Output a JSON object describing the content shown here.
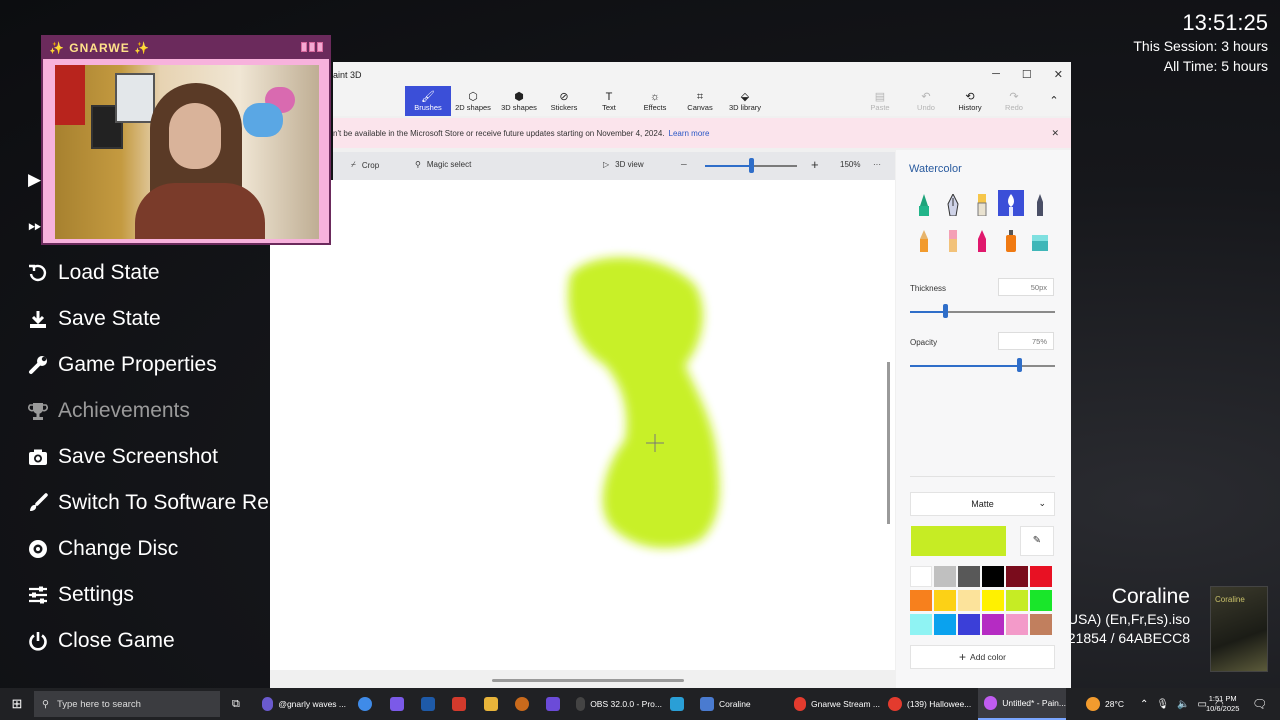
{
  "clock": {
    "time": "13:51:25",
    "session": "This Session: 3 hours",
    "all_time": "All Time: 5 hours"
  },
  "webcam": {
    "title": "✨ GNARWE ✨"
  },
  "emulator_menu": {
    "items": [
      {
        "label": "Load State",
        "icon": "undo-icon",
        "disabled": false
      },
      {
        "label": "Save State",
        "icon": "download-icon",
        "disabled": false
      },
      {
        "label": "Game Properties",
        "icon": "wrench-icon",
        "disabled": false
      },
      {
        "label": "Achievements",
        "icon": "trophy-icon",
        "disabled": true
      },
      {
        "label": "Save Screenshot",
        "icon": "camera-icon",
        "disabled": false
      },
      {
        "label": "Switch To Software Renderer",
        "icon": "brush-icon",
        "disabled": false
      },
      {
        "label": "Change Disc",
        "icon": "disc-icon",
        "disabled": false
      },
      {
        "label": "Settings",
        "icon": "sliders-icon",
        "disabled": false
      },
      {
        "label": "Close Game",
        "icon": "power-icon",
        "disabled": false
      }
    ]
  },
  "game_info": {
    "title": "Coraline",
    "region": "(USA) (En,Fr,Es).iso",
    "checksum": "21854 / 64ABECC8",
    "cover_text": "Coraline"
  },
  "paint": {
    "app_title": "aint 3D",
    "ribbon": [
      {
        "label": "Brushes",
        "icon": "brush-icon",
        "active": true
      },
      {
        "label": "2D shapes",
        "icon": "shapes-2d-icon",
        "active": false
      },
      {
        "label": "3D shapes",
        "icon": "cube-icon",
        "active": false
      },
      {
        "label": "Stickers",
        "icon": "sticker-icon",
        "active": false
      },
      {
        "label": "Text",
        "icon": "text-icon",
        "active": false
      },
      {
        "label": "Effects",
        "icon": "sun-icon",
        "active": false
      },
      {
        "label": "Canvas",
        "icon": "crop-icon",
        "active": false
      },
      {
        "label": "3D library",
        "icon": "library-icon",
        "active": false
      }
    ],
    "right_actions": [
      {
        "label": "Paste",
        "icon": "paste-icon",
        "enabled": false
      },
      {
        "label": "Undo",
        "icon": "undo-icon",
        "enabled": false
      },
      {
        "label": "History",
        "icon": "history-icon",
        "enabled": true
      },
      {
        "label": "Redo",
        "icon": "redo-icon",
        "enabled": false
      }
    ],
    "notice": {
      "text": "n't be available in the Microsoft Store or receive future updates starting on November 4, 2024.",
      "link": "Learn more"
    },
    "toolbar": {
      "crop": "Crop",
      "magic_select": "Magic select",
      "view3d": "3D view",
      "zoom": "150%",
      "more": "···"
    },
    "panel": {
      "heading": "Watercolor",
      "thickness_label": "Thickness",
      "thickness_value": "50px",
      "thickness_level": 0.24,
      "opacity_label": "Opacity",
      "opacity_value": "75%",
      "opacity_level": 0.75,
      "finish": "Matte",
      "current_color": "#c6ec24",
      "add_color": "Add color",
      "palette": [
        "#ffffff",
        "#c0c0c0",
        "#585858",
        "#000000",
        "#7a0c1c",
        "#e81123",
        "#f7801d",
        "#fcd116",
        "#fce39b",
        "#fff100",
        "#c6ec24",
        "#19e62a",
        "#8ff3f3",
        "#0aa2ee",
        "#3b3fd8",
        "#b52bc3",
        "#f39ac9",
        "#c17f5e"
      ]
    }
  },
  "taskbar": {
    "search_placeholder": "Type here to search",
    "items": [
      {
        "label": "@gnarly waves ...",
        "color": "#6a5acd",
        "active": false
      },
      {
        "label": "",
        "color": "#3f8be8",
        "active": false
      },
      {
        "label": "OBS 32.0.0 - Pro...",
        "color": "#444444",
        "active": false
      },
      {
        "label": "Coraline",
        "color": "#4a7bd0",
        "active": false
      },
      {
        "label": "Gnarwe Stream ...",
        "color": "#e33b2e",
        "active": false
      },
      {
        "label": "(139) Hallowee...",
        "color": "#e33b2e",
        "active": false
      },
      {
        "label": "Untitled* - Pain...",
        "color": "#c05cf0",
        "active": true
      }
    ],
    "weather": "28°C",
    "time": "1:51 PM",
    "date": "10/6/2025"
  }
}
